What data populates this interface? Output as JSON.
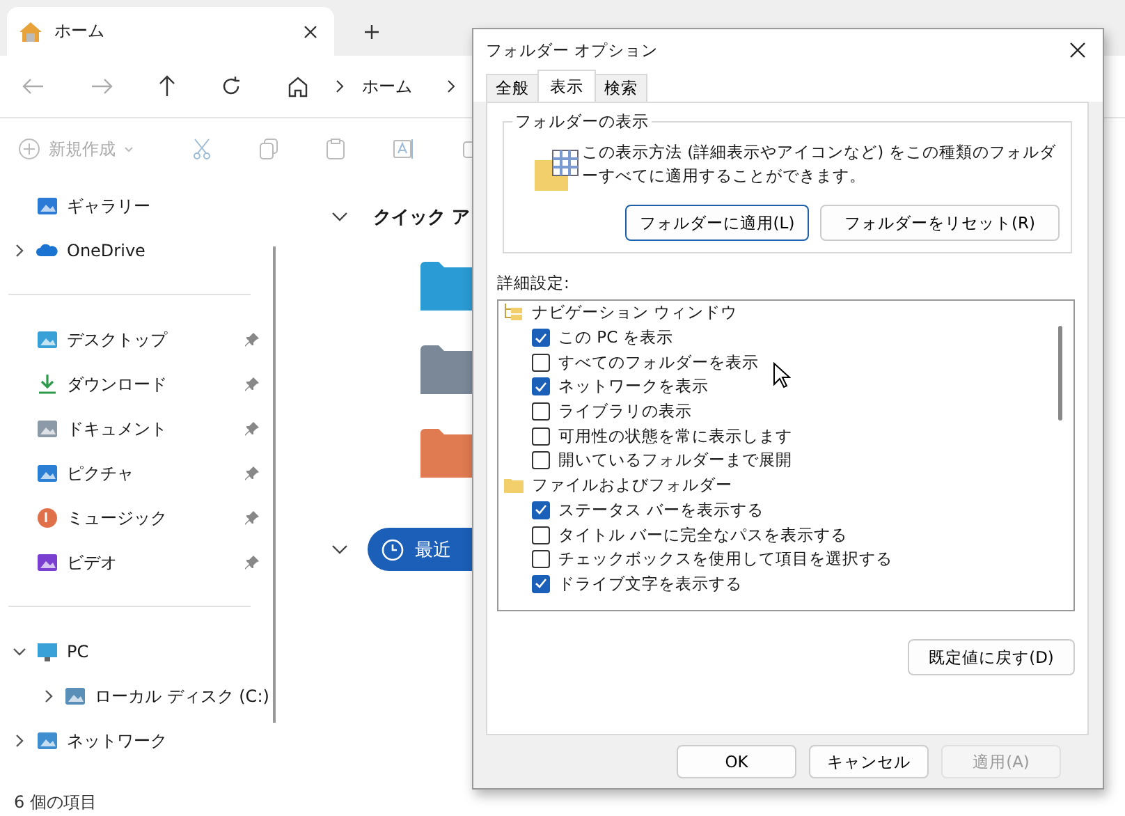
{
  "explorer": {
    "tab": {
      "title": "ホーム"
    },
    "breadcrumb": [
      "ホーム"
    ],
    "toolbar": {
      "new_label": "新規作成"
    },
    "sidebar": {
      "sections": [
        [
          {
            "label": "ギャラリー",
            "kind": "gallery",
            "pinned": false
          },
          {
            "label": "OneDrive",
            "kind": "cloud",
            "pinned": false,
            "expanded": false
          }
        ],
        [
          {
            "label": "デスクトップ",
            "kind": "desktop",
            "pinned": true
          },
          {
            "label": "ダウンロード",
            "kind": "download",
            "pinned": true
          },
          {
            "label": "ドキュメント",
            "kind": "document",
            "pinned": true
          },
          {
            "label": "ピクチャ",
            "kind": "pictures",
            "pinned": true
          },
          {
            "label": "ミュージック",
            "kind": "music",
            "pinned": true
          },
          {
            "label": "ビデオ",
            "kind": "video",
            "pinned": true
          }
        ],
        [
          {
            "label": "PC",
            "kind": "pc",
            "pinned": false,
            "expanded": true,
            "children": [
              {
                "label": "ローカル ディスク (C:)",
                "kind": "drive",
                "pinned": false,
                "expanded": false
              }
            ]
          },
          {
            "label": "ネットワーク",
            "kind": "network",
            "pinned": false,
            "expanded": false
          }
        ]
      ]
    },
    "content": {
      "quick_access": {
        "title": "クイック ア",
        "expanded": true,
        "folders": [
          {
            "kind": "desktop"
          },
          {
            "kind": "document"
          },
          {
            "kind": "music"
          }
        ]
      },
      "recent": {
        "title": "最近",
        "expanded": true
      }
    },
    "status_bar": "6 個の項目"
  },
  "dialog": {
    "title": "フォルダー オプション",
    "tabs": [
      {
        "label": "全般",
        "selected": false
      },
      {
        "label": "表示",
        "selected": true
      },
      {
        "label": "検索",
        "selected": false
      }
    ],
    "folder_views": {
      "title": "フォルダーの表示",
      "text": "この表示方法 (詳細表示やアイコンなど) をこの種類のフォルダーすべてに適用することができます。",
      "buttons": [
        {
          "label": "フォルダーに適用(L)",
          "focused": true
        },
        {
          "label": "フォルダーをリセット(R)",
          "focused": false
        }
      ]
    },
    "advanced": {
      "label": "詳細設定:",
      "groups": [
        {
          "label": "ナビゲーション ウィンドウ",
          "kind": "nav",
          "children": [
            {
              "label": "この PC を表示",
              "checked": true
            },
            {
              "label": "すべてのフォルダーを表示",
              "checked": false
            },
            {
              "label": "ネットワークを表示",
              "checked": true
            },
            {
              "label": "ライブラリの表示",
              "checked": false
            },
            {
              "label": "可用性の状態を常に表示します",
              "checked": false
            },
            {
              "label": "開いているフォルダーまで展開",
              "checked": false
            }
          ]
        },
        {
          "label": "ファイルおよびフォルダー",
          "kind": "folder",
          "children": [
            {
              "label": "ステータス バーを表示する",
              "checked": true
            },
            {
              "label": "タイトル バーに完全なパスを表示する",
              "checked": false
            },
            {
              "label": "チェックボックスを使用して項目を選択する",
              "checked": false
            },
            {
              "label": "ドライブ文字を表示する",
              "checked": true
            }
          ]
        }
      ]
    },
    "restore_button": "既定値に戻す(D)",
    "footer_buttons": [
      {
        "label": "OK",
        "disabled": false
      },
      {
        "label": "キャンセル",
        "disabled": false
      },
      {
        "label": "適用(A)",
        "disabled": true
      }
    ]
  }
}
